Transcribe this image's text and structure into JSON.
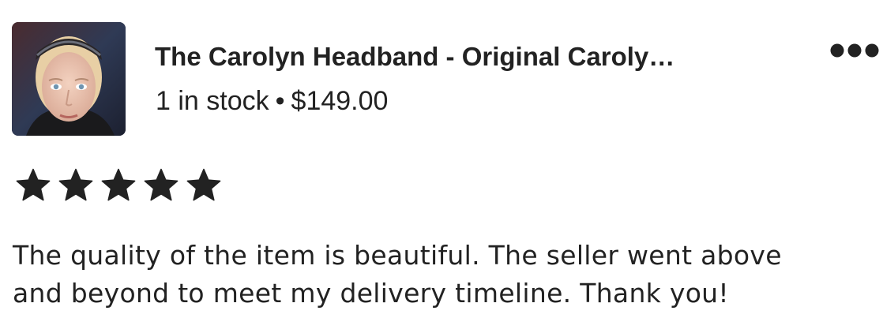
{
  "listing": {
    "title": "The Carolyn Headband - Original Caroly…",
    "stock": "1 in stock",
    "separator": "•",
    "price": "$149.00",
    "thumbnail_icon": "product-photo-headband"
  },
  "menu": {
    "icon": "more-options-icon"
  },
  "rating": {
    "stars": 5,
    "max": 5,
    "star_color": "#222222"
  },
  "review": {
    "text": "The quality of the item is beautiful.  The seller went above\nand beyond to meet my delivery timeline.  Thank you!"
  }
}
